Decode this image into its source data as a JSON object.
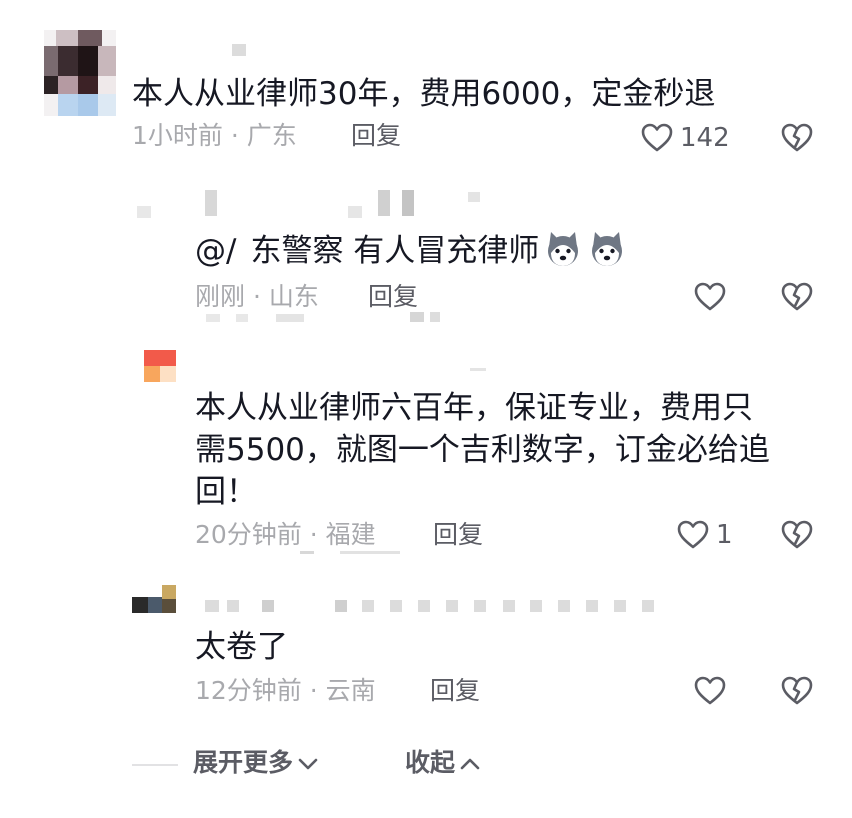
{
  "comments": [
    {
      "text": "本人从业律师30年，费用6000，定金秒退",
      "time_location": "1小时前 · 广东",
      "reply_label": "回复",
      "like_count": "142"
    },
    {
      "text_prefix": "@/",
      "text_main": "东警察 有人冒充律师",
      "time_location": "刚刚 · 山东",
      "reply_label": "回复"
    },
    {
      "text_line1": "本人从业律师六百年，保证专业，费用只",
      "text_line2": "需5500，就图一个吉利数字，订金必给追",
      "text_line3": "回！",
      "time_location": "20分钟前 · 福建",
      "reply_label": "回复",
      "like_count": "1"
    },
    {
      "text": "太卷了",
      "time_location": "12分钟前 · 云南",
      "reply_label": "回复"
    }
  ],
  "footer": {
    "expand_label": "展开更多",
    "collapse_label": "收起"
  },
  "icons": {
    "like": "heart-outline-icon",
    "dislike": "broken-heart-icon",
    "expand": "chevron-down-icon",
    "collapse": "chevron-up-icon",
    "emoji": "husky-dog-emoji"
  },
  "colors": {
    "text": "#161823",
    "meta": "#a8a9ad",
    "action": "#5b5c64"
  }
}
